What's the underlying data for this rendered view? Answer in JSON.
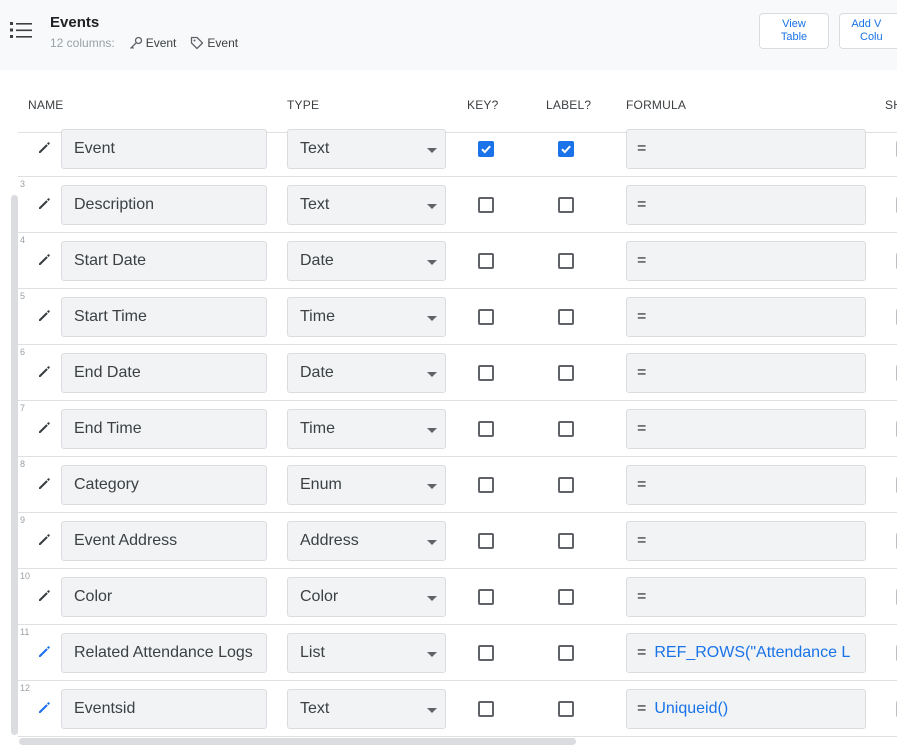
{
  "header": {
    "title": "Events",
    "columns_count": "12 columns:",
    "key_chip": "Event",
    "label_chip": "Event",
    "view_table_line1": "View",
    "view_table_line2": "Table",
    "add_column_line1": "Add V",
    "add_column_line2": "Colu"
  },
  "columns": {
    "name": "NAME",
    "type": "TYPE",
    "key": "KEY?",
    "label": "LABEL?",
    "formula": "FORMULA",
    "show": "SH"
  },
  "rows": [
    {
      "num": "",
      "name": "Event",
      "type": "Text",
      "key": true,
      "label": true,
      "formula": "",
      "edited": false
    },
    {
      "num": "3",
      "name": "Description",
      "type": "Text",
      "key": false,
      "label": false,
      "formula": "",
      "edited": false
    },
    {
      "num": "4",
      "name": "Start Date",
      "type": "Date",
      "key": false,
      "label": false,
      "formula": "",
      "edited": false
    },
    {
      "num": "5",
      "name": "Start Time",
      "type": "Time",
      "key": false,
      "label": false,
      "formula": "",
      "edited": false
    },
    {
      "num": "6",
      "name": "End Date",
      "type": "Date",
      "key": false,
      "label": false,
      "formula": "",
      "edited": false
    },
    {
      "num": "7",
      "name": "End Time",
      "type": "Time",
      "key": false,
      "label": false,
      "formula": "",
      "edited": false
    },
    {
      "num": "8",
      "name": "Category",
      "type": "Enum",
      "key": false,
      "label": false,
      "formula": "",
      "edited": false
    },
    {
      "num": "9",
      "name": "Event Address",
      "type": "Address",
      "key": false,
      "label": false,
      "formula": "",
      "edited": false
    },
    {
      "num": "10",
      "name": "Color",
      "type": "Color",
      "key": false,
      "label": false,
      "formula": "",
      "edited": false
    },
    {
      "num": "11",
      "name": "Related Attendance Logs",
      "type": "List",
      "key": false,
      "label": false,
      "formula": "REF_ROWS(\"Attendance L",
      "edited": true
    },
    {
      "num": "12",
      "name": "Eventsid",
      "type": "Text",
      "key": false,
      "label": false,
      "formula": "Uniqueid()",
      "edited": true
    }
  ],
  "formula_prefix": "=",
  "colors": {
    "accent": "#1a73e8",
    "icon": "#3c4043"
  }
}
